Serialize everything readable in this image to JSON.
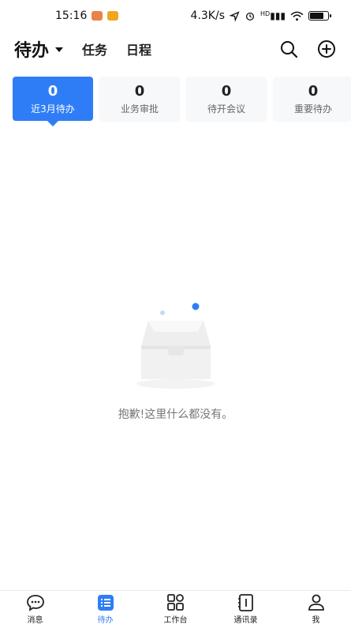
{
  "status_bar": {
    "time": "15:16",
    "network_speed": "4.3K/s",
    "signal_text": "HD"
  },
  "header": {
    "title": "待办",
    "tabs": [
      "任务",
      "日程"
    ],
    "search_icon": "search-icon",
    "add_icon": "add-circle-icon"
  },
  "summary_cards": [
    {
      "count": "0",
      "label": "近3月待办",
      "active": true
    },
    {
      "count": "0",
      "label": "业务审批",
      "active": false
    },
    {
      "count": "0",
      "label": "待开会议",
      "active": false
    },
    {
      "count": "0",
      "label": "重要待办",
      "active": false
    }
  ],
  "empty_state": {
    "message": "抱歉!这里什么都没有。",
    "icon": "empty-box-icon"
  },
  "bottom_nav": [
    {
      "label": "消息",
      "icon": "chat-bubble-icon"
    },
    {
      "label": "待办",
      "icon": "list-icon"
    },
    {
      "label": "工作台",
      "icon": "grid-icon"
    },
    {
      "label": "通讯录",
      "icon": "contacts-book-icon"
    },
    {
      "label": "我",
      "icon": "user-icon"
    }
  ],
  "colors": {
    "accent": "#2f7df6",
    "card_bg": "#f7f8fa",
    "text_muted": "#777777"
  }
}
